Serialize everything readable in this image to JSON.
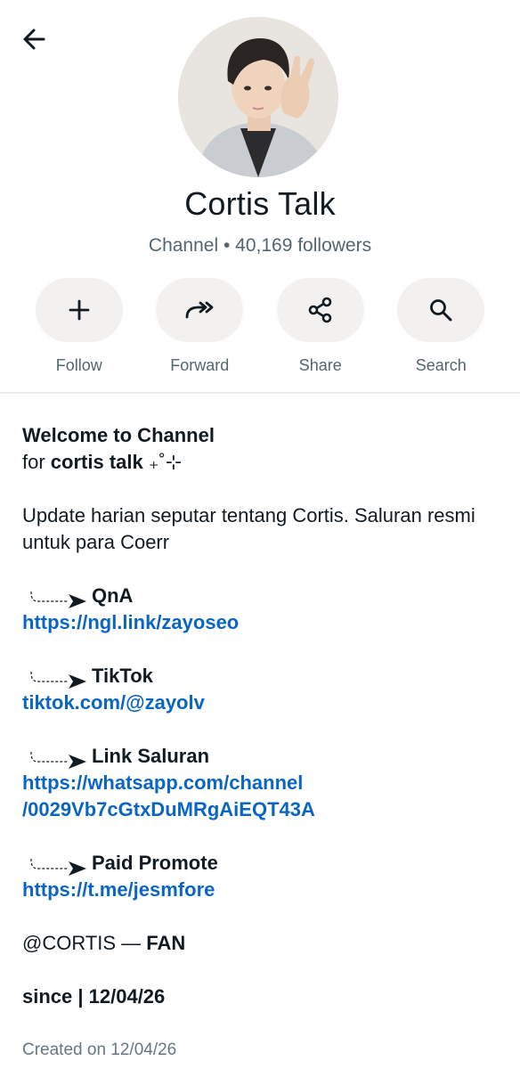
{
  "header": {
    "back_icon": "arrow-left-icon"
  },
  "channel": {
    "name": "Cortis Talk",
    "subtitle": "Channel • 40,169 followers"
  },
  "actions": [
    {
      "label": "Follow",
      "icon": "plus-icon"
    },
    {
      "label": "Forward",
      "icon": "forward-icon"
    },
    {
      "label": "Share",
      "icon": "share-icon"
    },
    {
      "label": "Search",
      "icon": "search-icon"
    }
  ],
  "description": {
    "welcome_title": "Welcome to Channel",
    "for_prefix": "for ",
    "for_name": "cortis talk",
    "sparkle": " ₊˚⊹",
    "update_text": "Update harian seputar tentang Cortis. Saluran resmi untuk para Coerr",
    "sections": [
      {
        "heading": "QnA",
        "links": [
          "https://ngl.link/zayoseo"
        ]
      },
      {
        "heading": "TikTok",
        "links": [
          "tiktok.com/@zayolv"
        ]
      },
      {
        "heading": "Link Saluran",
        "links": [
          "https://whatsapp.com/channel",
          "/0029Vb7cGtxDuMRgAiEQT43A"
        ]
      },
      {
        "heading": "Paid Promote",
        "links": [
          "https://t.me/jesmfore"
        ]
      }
    ],
    "fan_prefix": "@CORTIS — ",
    "fan_bold": "FAN",
    "since": "since | 12/04/26"
  },
  "footer": {
    "created": "Created on 12/04/26"
  }
}
